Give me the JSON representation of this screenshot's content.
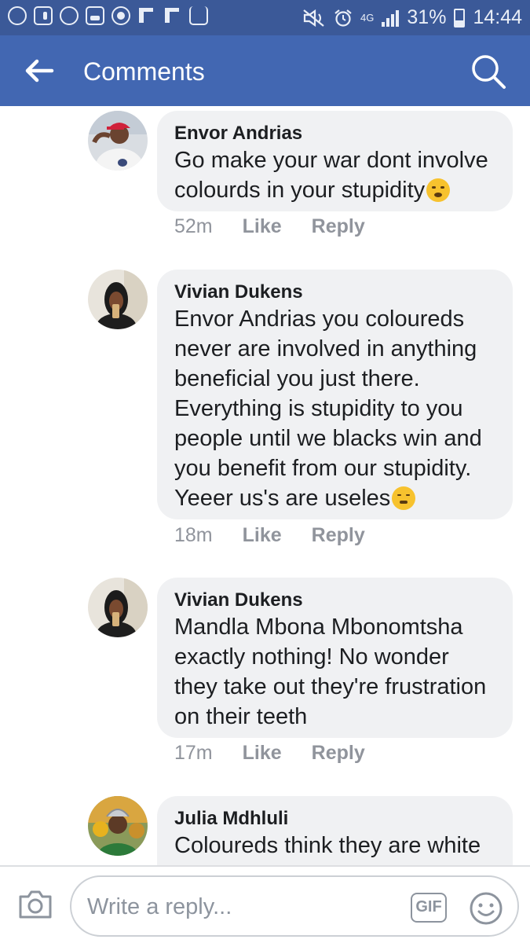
{
  "status_bar": {
    "network": "4G",
    "battery": "31%",
    "battery_level": 0.31,
    "time": "14:44",
    "icons": [
      "whatsapp-icon",
      "facebook-icon",
      "messenger-icon",
      "gallery-icon",
      "phone-icon",
      "flipboard-icon",
      "flipboard-icon",
      "download-icon",
      "mute-icon",
      "alarm-icon",
      "signal-icon",
      "battery-icon"
    ]
  },
  "header": {
    "title": "Comments",
    "back_icon": "arrow-left-icon",
    "search_icon": "search-icon"
  },
  "colors": {
    "header": "#4267b2",
    "status_bar": "#3b5998",
    "bubble": "#f0f1f3",
    "meta": "#90949c"
  },
  "comments": [
    {
      "author": "Envor Andrias",
      "text": "Go make your war dont involve colourds in your stupidity",
      "emoji": "wink-face-emoji",
      "time": "52m",
      "like_label": "Like",
      "reply_label": "Reply"
    },
    {
      "author": "Vivian Dukens",
      "text": "Envor Andrias you coloureds never are involved in anything beneficial you just there. Everything is stupidity to you people until we blacks win and you benefit from our stupidity. Yeeer us's are useles",
      "emoji": "sleeping-face-emoji",
      "time": "18m",
      "like_label": "Like",
      "reply_label": "Reply"
    },
    {
      "author": "Vivian Dukens",
      "text": "Mandla Mbona Mbonomtsha exactly nothing! No wonder they take out they're frustration on their teeth",
      "time": "17m",
      "like_label": "Like",
      "reply_label": "Reply"
    },
    {
      "author": "Julia Mdhluli",
      "text": "Coloureds think they are white"
    }
  ],
  "reply_bar": {
    "placeholder": "Write a reply...",
    "camera_icon": "camera-icon",
    "gif_label": "GIF",
    "emoji_icon": "smiley-icon"
  }
}
